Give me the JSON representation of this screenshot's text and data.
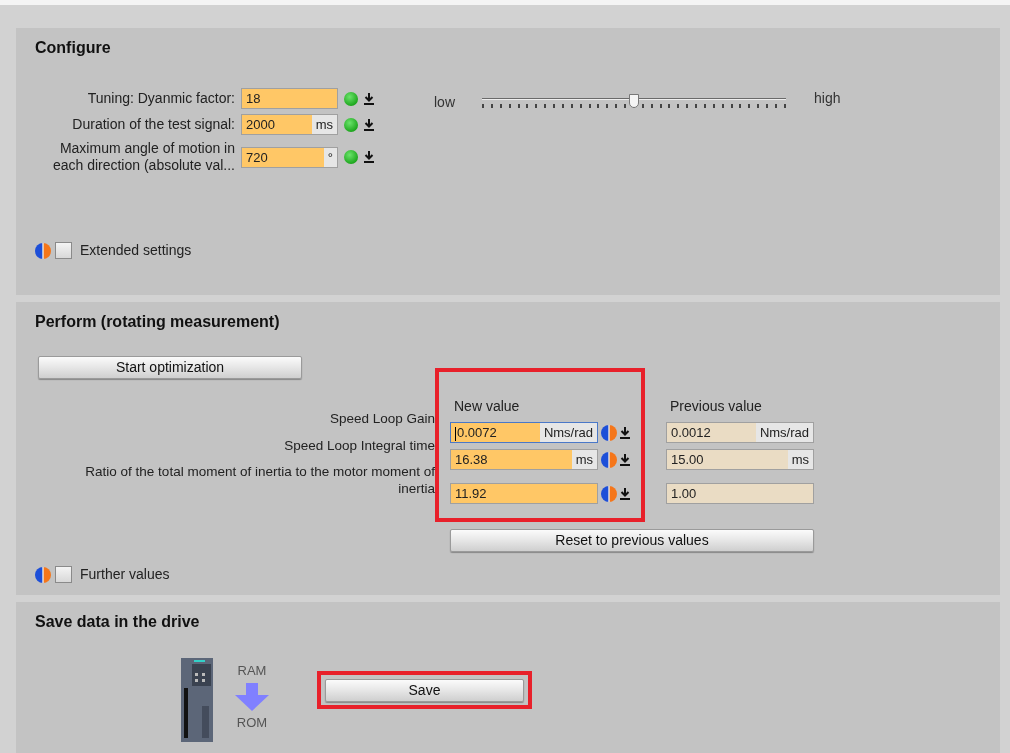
{
  "configure": {
    "title": "Configure",
    "parameters": [
      {
        "label": "Tuning: Dyanmic factor:",
        "value": "18",
        "kind": "ok"
      },
      {
        "label": "Duration of the test signal:",
        "value": "2000",
        "unit": "ms",
        "kind": "ok"
      },
      {
        "label": "Maximum angle of motion in each direction (absolute val...",
        "value": "720",
        "unit": "°",
        "kind": "ok"
      }
    ],
    "slider": {
      "low_label": "low",
      "high_label": "high",
      "level": 0.5
    },
    "extended_settings": {
      "label": "Extended settings",
      "checked": false
    }
  },
  "perform": {
    "title": "Perform (rotating measurement)",
    "start_button": "Start optimization",
    "new_value_header": "New value",
    "previous_value_header": "Previous value",
    "highlighted": true,
    "rows": [
      {
        "label": "Speed Loop Gain",
        "new_value": "0.0072",
        "new_unit": "Nms/rad",
        "previous_value": "0.0012",
        "previous_unit": "Nms/rad",
        "focused": true
      },
      {
        "label": "Speed Loop Integral time",
        "new_value": "16.38",
        "new_unit": "ms",
        "previous_value": "15.00",
        "previous_unit": "ms",
        "focused": false
      },
      {
        "label": "Ratio of the total moment of inertia to the motor moment of inertia",
        "new_value": "11.92",
        "previous_value": "1.00",
        "focused": false
      }
    ],
    "reset_button": "Reset to previous values",
    "further_values": {
      "label": "Further values",
      "checked": false
    }
  },
  "save": {
    "title": "Save data in the drive",
    "ram_label": "RAM",
    "rom_label": "ROM",
    "save_button": "Save",
    "highlighted": true
  }
}
